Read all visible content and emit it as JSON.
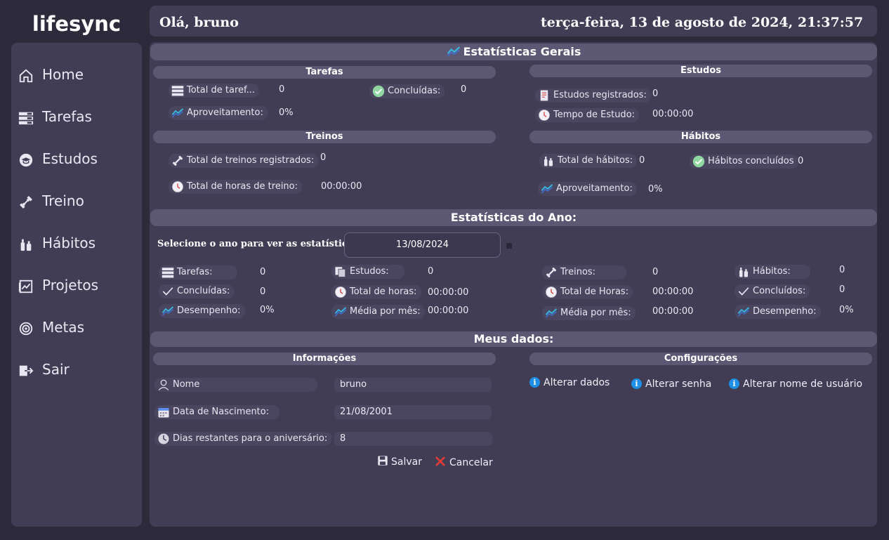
{
  "app": {
    "logo": "lifesync"
  },
  "header": {
    "greeting": "Olá, bruno",
    "datetime": "terça-feira, 13 de agosto de 2024, 21:37:57"
  },
  "sidebar": {
    "items": [
      {
        "label": "Home",
        "icon": "home-icon"
      },
      {
        "label": "Tarefas",
        "icon": "tasks-icon"
      },
      {
        "label": "Estudos",
        "icon": "graduation-icon"
      },
      {
        "label": "Treino",
        "icon": "dumbbell-icon"
      },
      {
        "label": "Hábitos",
        "icon": "bottles-icon"
      },
      {
        "label": "Projetos",
        "icon": "projects-icon"
      },
      {
        "label": "Metas",
        "icon": "target-icon"
      },
      {
        "label": "Sair",
        "icon": "logout-icon"
      }
    ]
  },
  "stats_general": {
    "title": "Estatísticas Gerais",
    "tarefas": {
      "title": "Tarefas",
      "total_label": "Total de taref...",
      "total_value": "0",
      "done_label": "Concluídas:",
      "done_value": "0",
      "perf_label": "Aproveitamento:",
      "perf_value": "0%"
    },
    "estudos": {
      "title": "Estudos",
      "count_label": "Estudos registrados:",
      "count_value": "0",
      "time_label": "Tempo de Estudo:",
      "time_value": "00:00:00"
    },
    "treinos": {
      "title": "Treinos",
      "count_label": "Total de treinos registrados:",
      "count_value": "0",
      "hours_label": "Total de horas de treino:",
      "hours_value": "00:00:00"
    },
    "habitos": {
      "title": "Hábitos",
      "count_label": "Total de hábitos:",
      "count_value": "0",
      "done_label": "Hábitos concluídos",
      "done_value": "0",
      "perf_label": "Aproveitamento:",
      "perf_value": "0%"
    }
  },
  "stats_year": {
    "title": "Estatísticas do Ano:",
    "select_label": "Selecione o ano para ver as estatísticas!",
    "date_value": "13/08/2024",
    "tarefas": {
      "label": "Tarefas:",
      "value": "0",
      "done_label": "Concluídas:",
      "done_value": "0",
      "perf_label": "Desempenho:",
      "perf_value": "0%"
    },
    "estudos": {
      "label": "Estudos:",
      "value": "0",
      "hours_label": "Total de horas:",
      "hours_value": "00:00:00",
      "avg_label": "Média por mês:",
      "avg_value": "00:00:00"
    },
    "treinos": {
      "label": "Treinos:",
      "value": "0",
      "hours_label": "Total de Horas:",
      "hours_value": "00:00:00",
      "avg_label": "Média por mês:",
      "avg_value": "00:00:00"
    },
    "habitos": {
      "label": "Hábitos:",
      "value": "0",
      "done_label": "Concluídos:",
      "done_value": "0",
      "perf_label": "Desempenho:",
      "perf_value": "0%"
    }
  },
  "my_data": {
    "title": "Meus dados:",
    "info": {
      "title": "Informações",
      "name_label": "Nome",
      "name_value": "bruno",
      "birth_label": "Data de Nascimento:",
      "birth_value": "21/08/2001",
      "days_label": "Dias restantes para o aniversário:",
      "days_value": "8",
      "save_label": "Salvar",
      "cancel_label": "Cancelar"
    },
    "config": {
      "title": "Configurações",
      "change_data": "Alterar dados",
      "change_password": "Alterar senha",
      "change_username": "Alterar nome de usuário"
    }
  },
  "colors": {
    "background": "#2c2a3b",
    "panel": "#413d55",
    "section_bar": "#5c5873",
    "chart_icon": "#38b6e0",
    "check_green": "#8fd6a0",
    "info_blue": "#1e8fe6",
    "cancel_red": "#e53935"
  }
}
